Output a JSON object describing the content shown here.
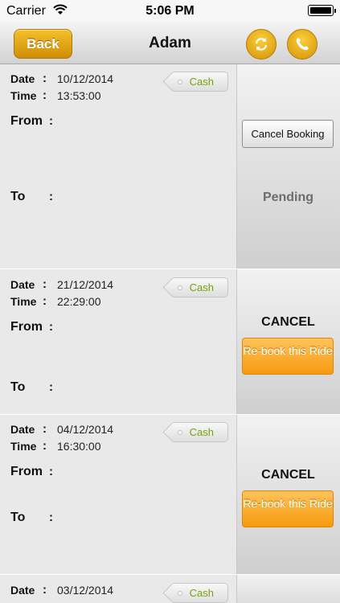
{
  "status_bar": {
    "carrier": "Carrier",
    "time": "5:06 PM"
  },
  "nav": {
    "back_label": "Back",
    "title": "Adam",
    "refresh_icon": "refresh-icon",
    "phone_icon": "phone-icon"
  },
  "labels": {
    "date": "Date",
    "time": "Time",
    "from": "From",
    "to": "To",
    "colon": ":"
  },
  "bookings": [
    {
      "date": "10/12/2014",
      "time": "13:53:00",
      "payment": "Cash",
      "action_button": "Cancel Booking",
      "status": "Pending"
    },
    {
      "date": "21/12/2014",
      "time": "22:29:00",
      "payment": "Cash",
      "status": "CANCEL",
      "rebook_label": "Re-book this Ride"
    },
    {
      "date": "04/12/2014",
      "time": "16:30:00",
      "payment": "Cash",
      "status": "CANCEL",
      "rebook_label": "Re-book this Ride"
    },
    {
      "date": "03/12/2014",
      "payment": "Cash"
    }
  ],
  "colors": {
    "accent": "#e8a91b",
    "cash_text": "#7aa10f",
    "rebook": "#f9a623"
  }
}
